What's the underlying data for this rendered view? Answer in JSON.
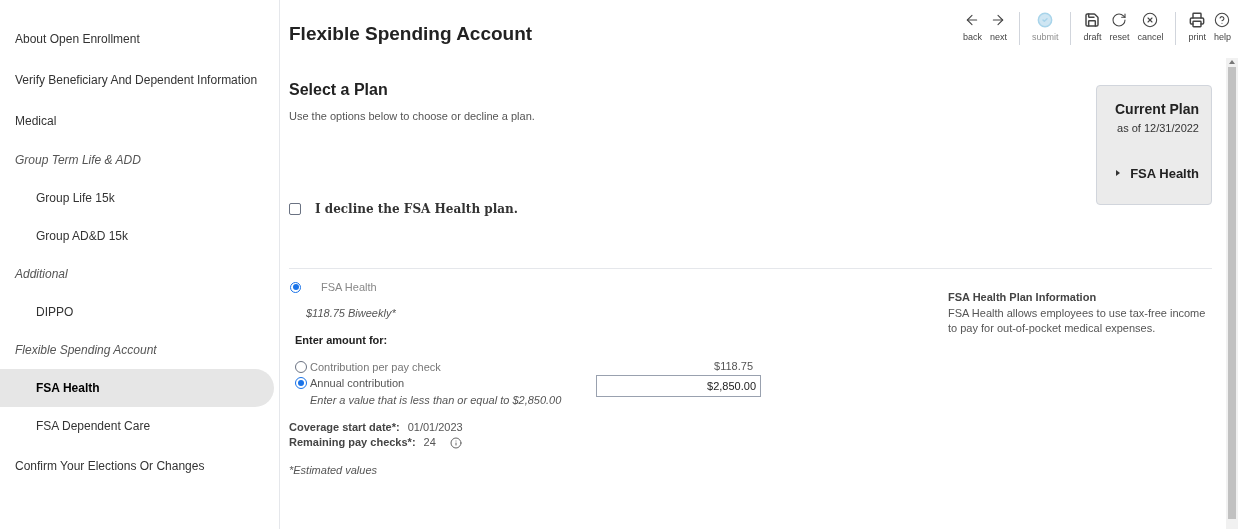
{
  "sidebar": {
    "items": [
      {
        "label": "About Open Enrollment",
        "kind": "link",
        "selected": false
      },
      {
        "label": "Verify Beneficiary And Dependent Information",
        "kind": "link",
        "selected": false
      },
      {
        "label": "Medical",
        "kind": "link",
        "selected": false
      },
      {
        "label": "Group Term Life & ADD",
        "kind": "group",
        "selected": false
      },
      {
        "label": "Group Life 15k",
        "kind": "sub",
        "selected": false
      },
      {
        "label": "Group AD&D 15k",
        "kind": "sub",
        "selected": false
      },
      {
        "label": "Additional",
        "kind": "group",
        "selected": false
      },
      {
        "label": "DIPPO",
        "kind": "sub",
        "selected": false
      },
      {
        "label": "Flexible Spending Account",
        "kind": "group",
        "selected": false
      },
      {
        "label": "FSA Health",
        "kind": "sub",
        "selected": true
      },
      {
        "label": "FSA Dependent Care",
        "kind": "sub",
        "selected": false
      },
      {
        "label": "Confirm Your Elections Or Changes",
        "kind": "link",
        "selected": false
      }
    ]
  },
  "page_title": "Flexible Spending Account",
  "toolbar": {
    "groups": [
      [
        {
          "label": "back",
          "disabled": false
        },
        {
          "label": "next",
          "disabled": false
        }
      ],
      [
        {
          "label": "submit",
          "disabled": true
        }
      ],
      [
        {
          "label": "draft",
          "disabled": false
        },
        {
          "label": "reset",
          "disabled": false
        },
        {
          "label": "cancel",
          "disabled": false
        }
      ],
      [
        {
          "label": "print",
          "disabled": false
        },
        {
          "label": "help",
          "disabled": false
        }
      ]
    ]
  },
  "section": {
    "title": "Select a Plan",
    "description": "Use the options below to choose or decline a plan."
  },
  "current_plan": {
    "title": "Current Plan",
    "as_of": "as of 12/31/2022",
    "plan": "FSA Health"
  },
  "decline": {
    "label": "I decline the FSA Health plan.",
    "checked": false
  },
  "plan": {
    "name": "FSA Health",
    "selected": true,
    "cost": "$118.75 Biweekly*",
    "amount_heading": "Enter amount for:",
    "options": [
      {
        "label": "Contribution per pay check",
        "selected": false,
        "value": "$118.75"
      },
      {
        "label": "Annual contribution",
        "selected": true,
        "value": "$2,850.00",
        "hint": "Enter a value that is less than or equal to $2,850.00"
      }
    ],
    "coverage_label": "Coverage start date*:",
    "coverage_value": "01/01/2023",
    "remaining_label": "Remaining pay checks*:",
    "remaining_value": "24",
    "footnote": "*Estimated values",
    "info_title": "FSA Health Plan Information",
    "info_text": "FSA Health allows employees to use tax-free income to pay for out-of-pocket medical expenses."
  }
}
